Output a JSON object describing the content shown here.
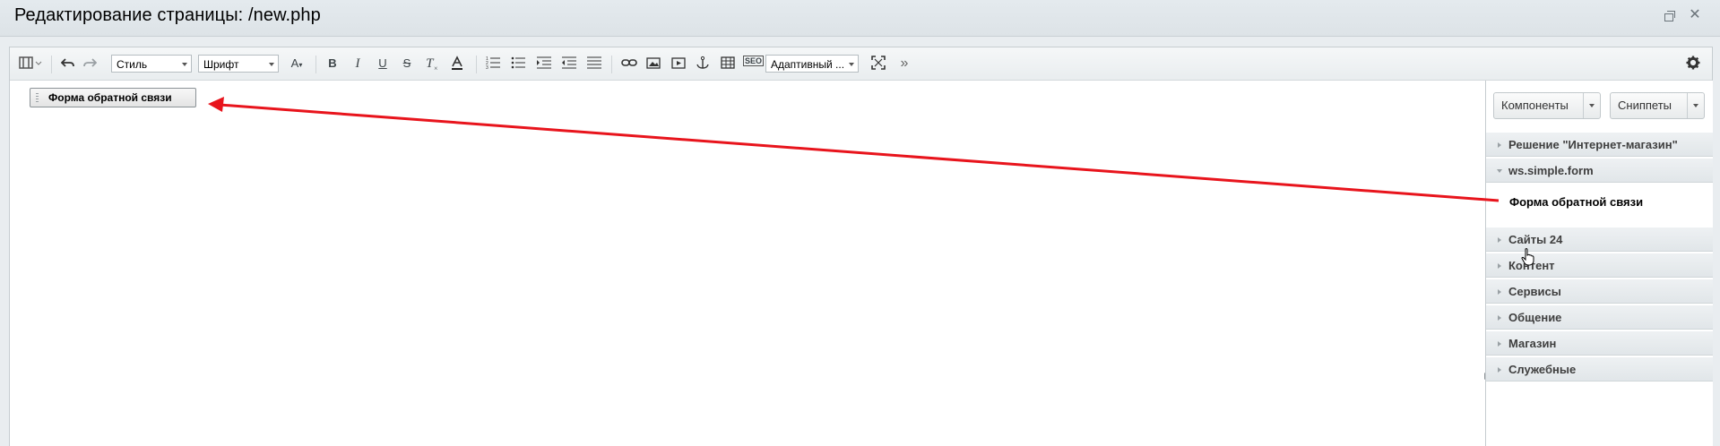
{
  "window": {
    "title": "Редактирование страницы: /new.php",
    "restore_icon": "restore-window-icon",
    "close_label": "✕"
  },
  "toolbar": {
    "style_select": "Стиль",
    "font_select": "Шрифт",
    "font_size_label": "A",
    "bold_label": "B",
    "italic_label": "I",
    "underline_label": "U",
    "strike_label": "S",
    "remove_format_label": "T",
    "seo_label": "SEO",
    "adaptive_select": "Адаптивный ...",
    "more_label": "»"
  },
  "content": {
    "component_block_label": "Форма обратной связи"
  },
  "panel": {
    "components_button": "Компоненты",
    "snippets_button": "Сниппеты",
    "groups": [
      {
        "label": "Решение \"Интернет-магазин\"",
        "expanded": false
      },
      {
        "label": "ws.simple.form",
        "expanded": true
      },
      {
        "label": "Сайты 24",
        "expanded": false
      },
      {
        "label": "Контент",
        "expanded": false
      },
      {
        "label": "Сервисы",
        "expanded": false
      },
      {
        "label": "Общение",
        "expanded": false
      },
      {
        "label": "Магазин",
        "expanded": false
      },
      {
        "label": "Служебные",
        "expanded": false
      }
    ],
    "expanded_item": "Форма обратной связи"
  },
  "colors": {
    "arrow": "#e8141c",
    "accent": "#3d4448"
  }
}
